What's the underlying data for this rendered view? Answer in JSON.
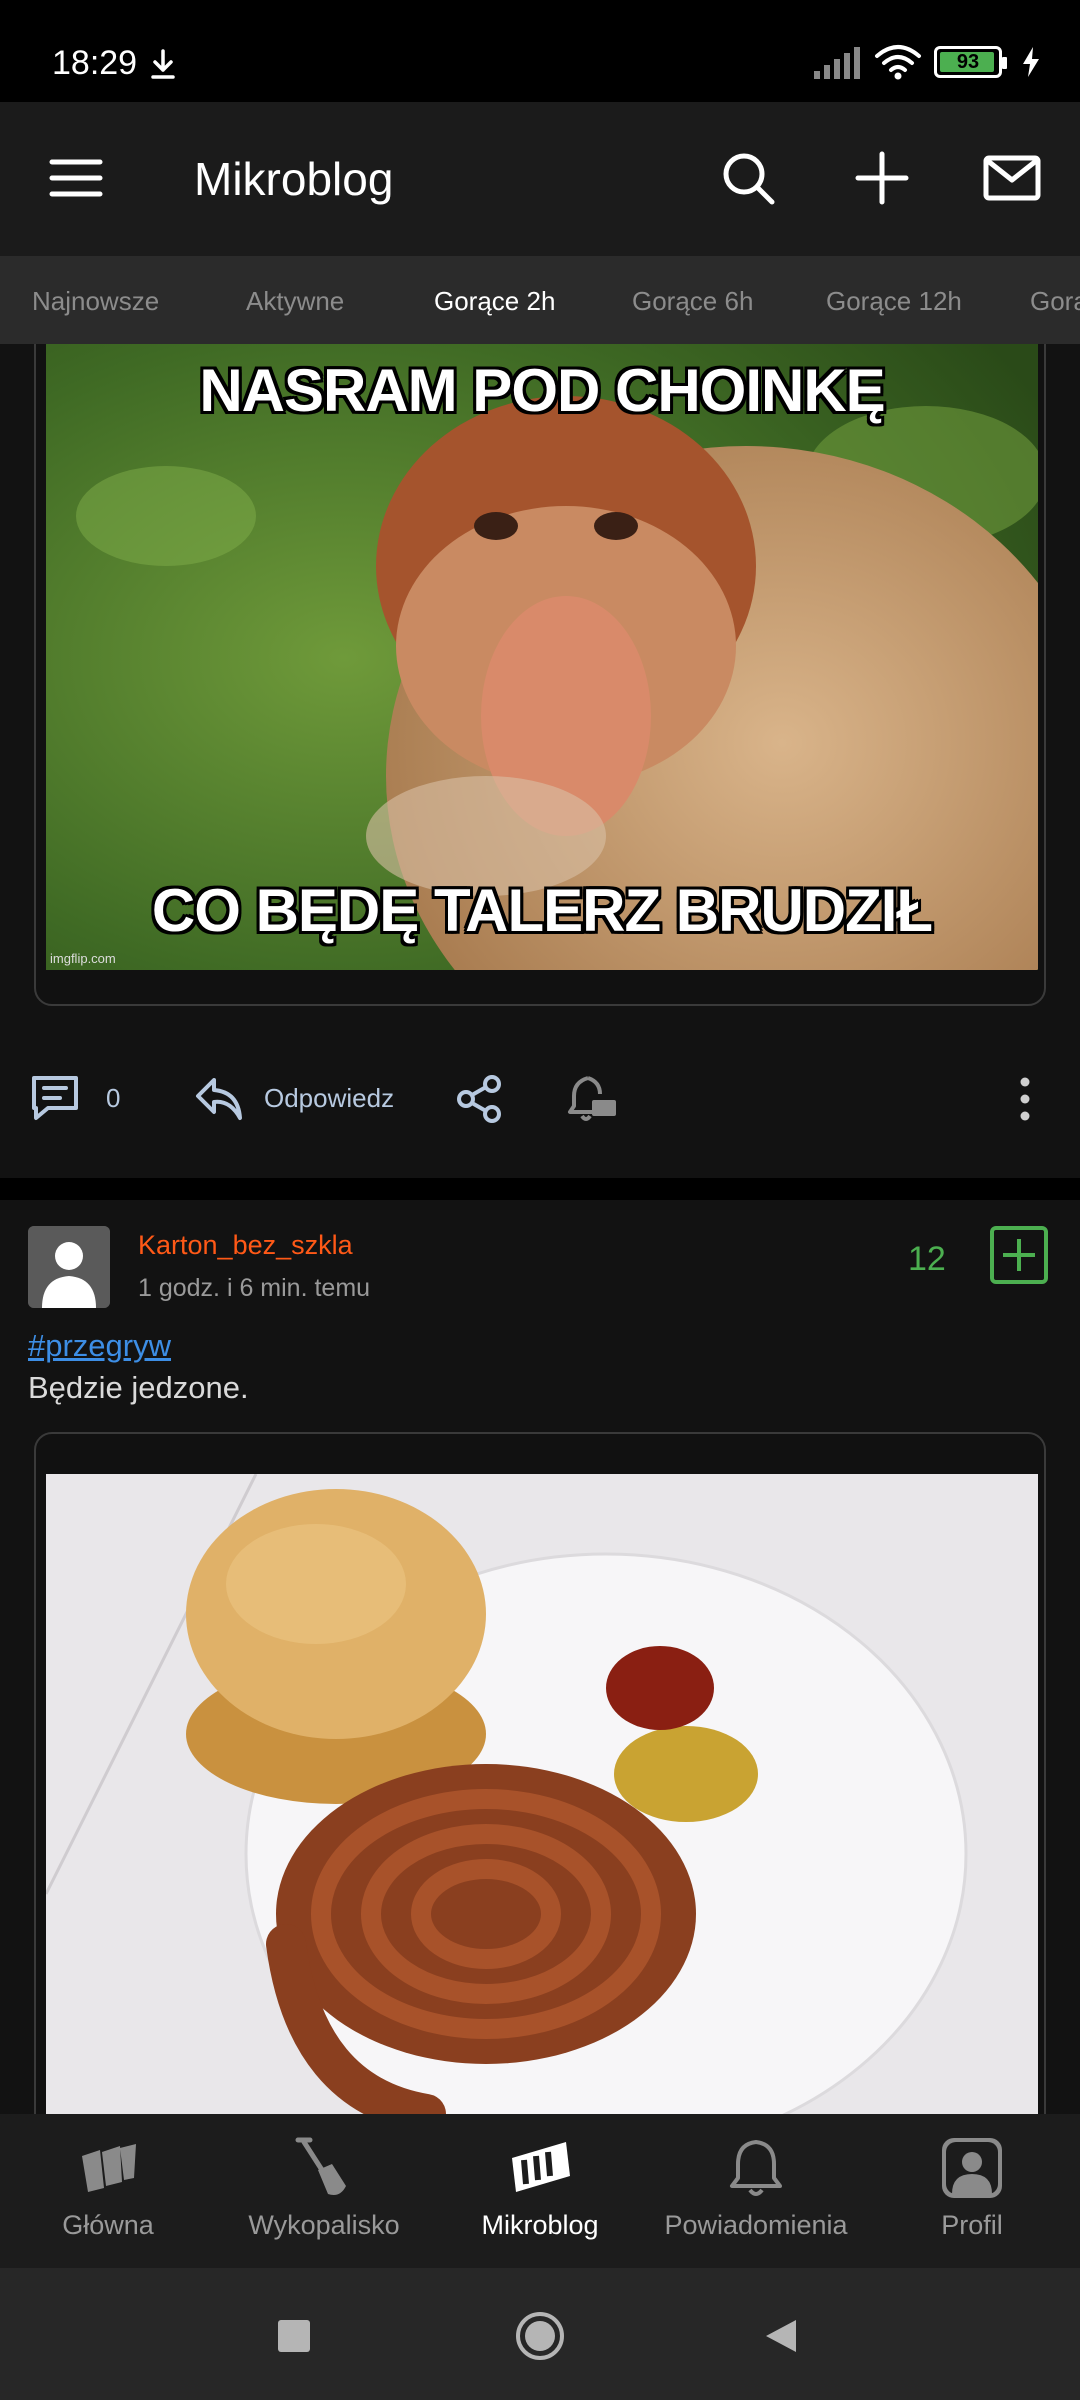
{
  "status_bar": {
    "time": "18:29",
    "battery": "93"
  },
  "app_bar": {
    "title": "Mikroblog"
  },
  "tabs": [
    {
      "label": "Najnowsze",
      "active": false
    },
    {
      "label": "Aktywne",
      "active": false
    },
    {
      "label": "Gorące 2h",
      "active": true
    },
    {
      "label": "Gorące 6h",
      "active": false
    },
    {
      "label": "Gorące 12h",
      "active": false
    },
    {
      "label": "Gorą",
      "active": false
    }
  ],
  "post1": {
    "image_top_text": "NASRAM POD CHOINKĘ",
    "image_bottom_text": "CO BĘDĘ TALERZ BRUDZIŁ",
    "watermark": "imgflip.com",
    "comments_count": "0",
    "reply_label": "Odpowiedz"
  },
  "post2": {
    "author": "Karton_bez_szkla",
    "time": "1 godz. i 6 min. temu",
    "votes": "12",
    "tag": "#przegryw",
    "body": "Będzie jedzone."
  },
  "bottom_nav": [
    {
      "label": "Główna",
      "icon": "home-logo-icon",
      "active": false
    },
    {
      "label": "Wykopalisko",
      "icon": "shovel-icon",
      "active": false
    },
    {
      "label": "Mikroblog",
      "icon": "mikroblog-logo-icon",
      "active": true
    },
    {
      "label": "Powiadomienia",
      "icon": "bell-icon",
      "active": false
    },
    {
      "label": "Profil",
      "icon": "profile-icon",
      "active": false
    }
  ],
  "colors": {
    "accent_orange": "#ff5917",
    "vote_green": "#4caf50",
    "tag_blue": "#3d8ee5"
  }
}
